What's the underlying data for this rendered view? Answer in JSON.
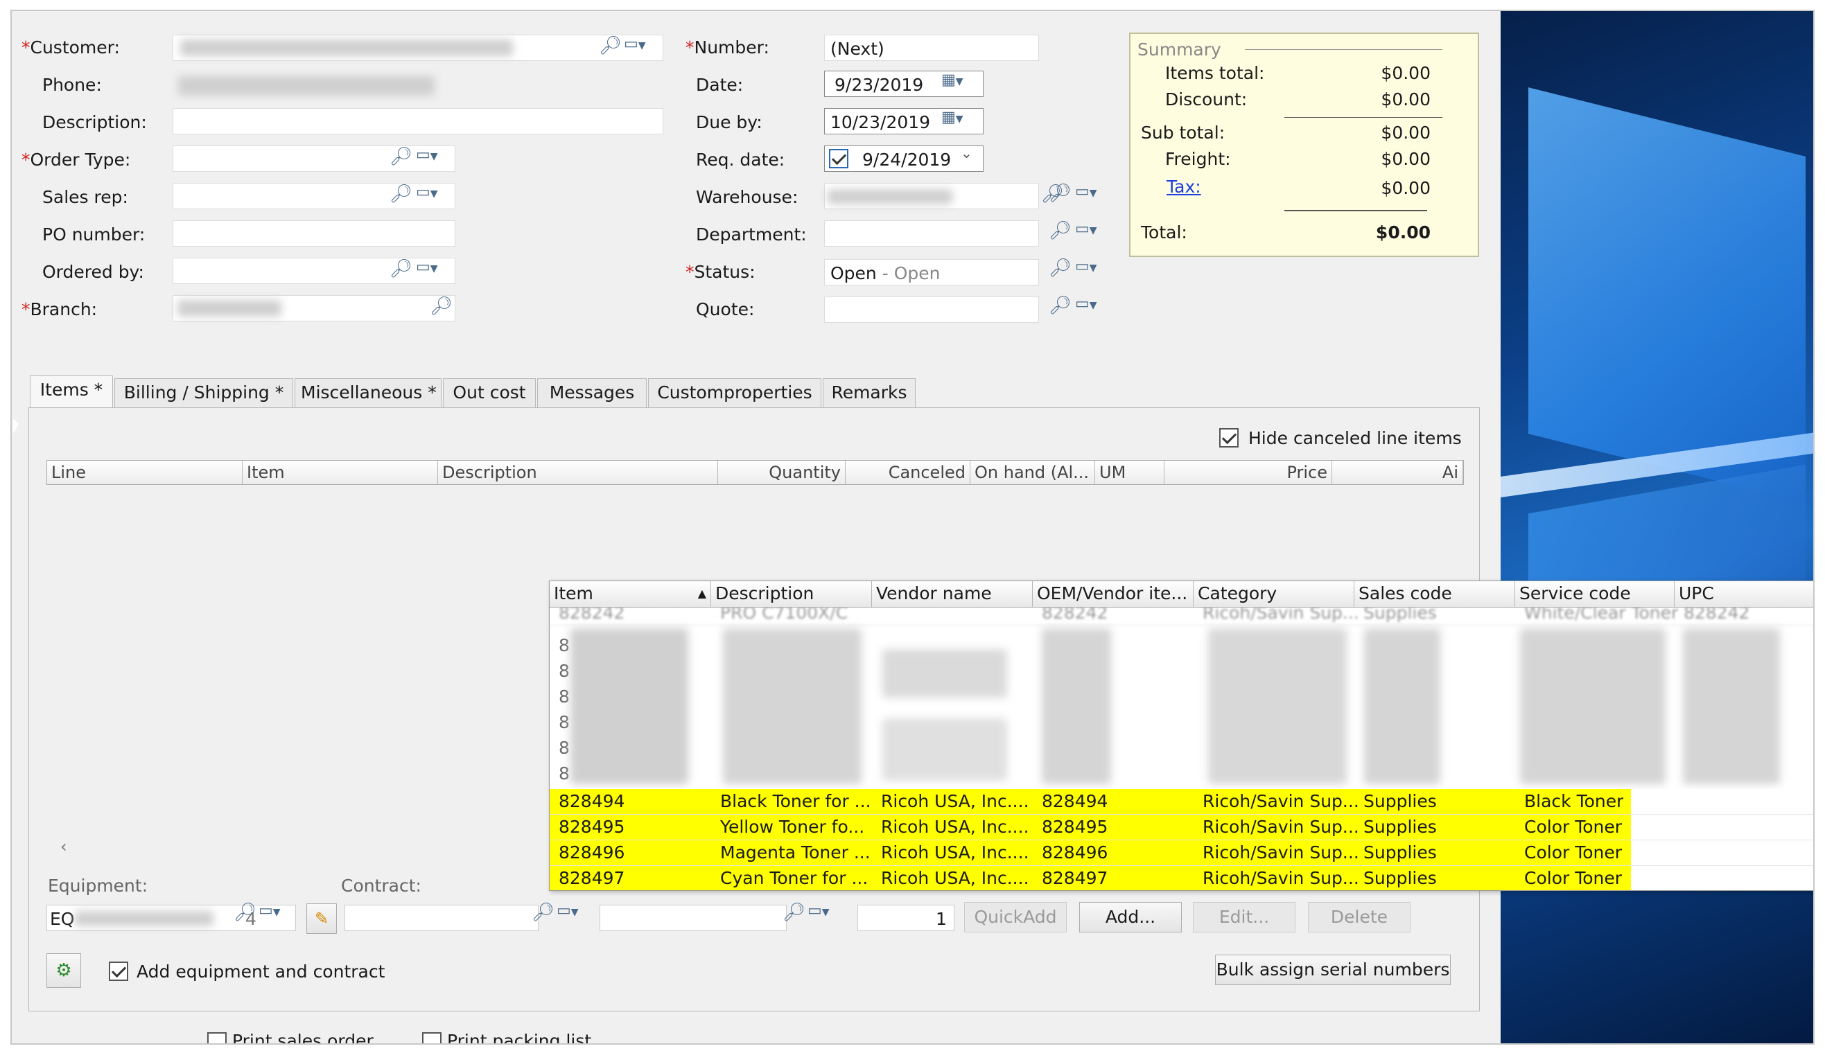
{
  "form": {
    "customer_label": "Customer:",
    "phone_label": "Phone:",
    "description_label": "Description:",
    "order_type_label": "Order Type:",
    "sales_rep_label": "Sales rep:",
    "po_number_label": "PO number:",
    "ordered_by_label": "Ordered by:",
    "branch_label": "Branch:",
    "number_label": "Number:",
    "number_value": "(Next)",
    "date_label": "Date:",
    "date_value": "9/23/2019",
    "due_by_label": "Due by:",
    "due_by_value": "10/23/2019",
    "req_date_label": "Req. date:",
    "req_date_value": "9/24/2019",
    "warehouse_label": "Warehouse:",
    "department_label": "Department:",
    "status_label": "Status:",
    "status_value": "Open",
    "status_desc": "- Open",
    "quote_label": "Quote:",
    "required_mark": "*"
  },
  "summary": {
    "title": "Summary",
    "items_total_label": "Items total:",
    "items_total": "$0.00",
    "discount_label": "Discount:",
    "discount": "$0.00",
    "sub_total_label": "Sub total:",
    "sub_total": "$0.00",
    "freight_label": "Freight:",
    "freight": "$0.00",
    "tax_label": "Tax:",
    "tax": "$0.00",
    "total_label": "Total:",
    "total": "$0.00"
  },
  "tabs": [
    "Items *",
    "Billing / Shipping  *",
    "Miscellaneous *",
    "Out cost",
    "Messages",
    "Customproperties",
    "Remarks"
  ],
  "items_tab": {
    "hide_canceled_label": "Hide canceled line items",
    "hide_canceled_checked": true,
    "columns": [
      "Line",
      "Item",
      "Description",
      "Quantity",
      "Canceled",
      "On hand (Al...",
      "UM",
      "Price",
      "Ai"
    ],
    "equipment_label": "Equipment:",
    "equipment_value": "EQ",
    "equipment_suffix": "4",
    "contract_label": "Contract:",
    "quantity_value": "1",
    "quickadd_label": "QuickAdd",
    "add_label": "Add...",
    "edit_label": "Edit...",
    "delete_label": "Delete",
    "add_equipment_label": "Add equipment and contract",
    "add_equipment_checked": true,
    "bulk_assign_label": "Bulk assign serial numbers",
    "print_sales_order_label": "Print sales order",
    "print_packing_list_label": "Print packing list"
  },
  "lookup": {
    "columns": [
      "Item",
      "Description",
      "Vendor name",
      "OEM/Vendor ite...",
      "Category",
      "Sales code",
      "Service code",
      "UPC"
    ],
    "partial_rows": [
      {
        "item": "828242",
        "description": "PRO C7100X/C",
        "oem": "828242",
        "category": "Ricoh/Savin Sup...",
        "sales": "Supplies",
        "service": "White/Clear Toner",
        "upc": "828242"
      },
      {
        "item": "8"
      },
      {
        "item": "8"
      },
      {
        "item": "8"
      },
      {
        "item": "8"
      },
      {
        "item": "8"
      },
      {
        "item": "8"
      }
    ],
    "rows": [
      {
        "item": "828494",
        "description": "Black Toner for ...",
        "vendor": "Ricoh USA, Inc....",
        "oem": "828494",
        "category": "Ricoh/Savin Sup...",
        "sales": "Supplies",
        "service": "Black Toner"
      },
      {
        "item": "828495",
        "description": "Yellow Toner fo...",
        "vendor": "Ricoh USA, Inc....",
        "oem": "828495",
        "category": "Ricoh/Savin Sup...",
        "sales": "Supplies",
        "service": "Color Toner"
      },
      {
        "item": "828496",
        "description": "Magenta Toner ...",
        "vendor": "Ricoh USA, Inc....",
        "oem": "828496",
        "category": "Ricoh/Savin Sup...",
        "sales": "Supplies",
        "service": "Color Toner"
      },
      {
        "item": "828497",
        "description": "Cyan Toner for ...",
        "vendor": "Ricoh USA, Inc....",
        "oem": "828497",
        "category": "Ricoh/Savin Sup...",
        "sales": "Supplies",
        "service": "Color Toner"
      }
    ],
    "highlight_color": "#ffff00"
  },
  "icons": {
    "search": "search-icon",
    "dropdown_menu": "dropdown-menu-icon",
    "calendar": "calendar-icon",
    "pencil": "pencil-icon",
    "equipment": "equipment-icon"
  }
}
